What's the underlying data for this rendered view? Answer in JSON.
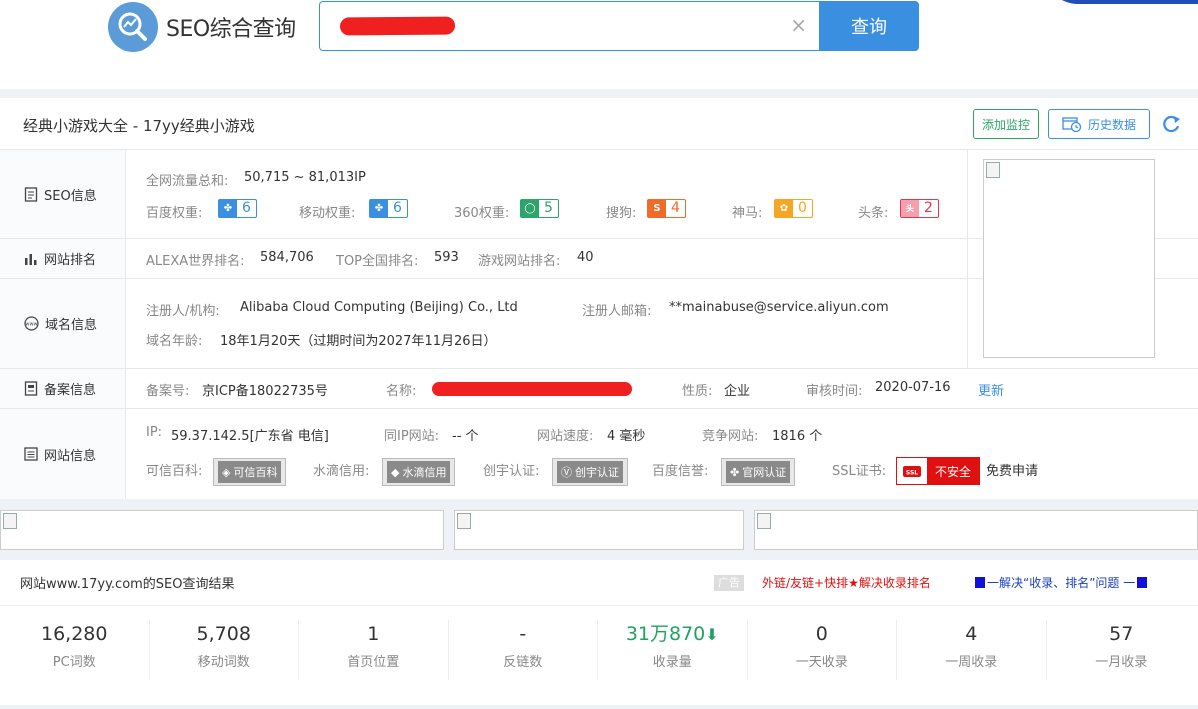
{
  "header": {
    "logo_text": "SEO综合查询",
    "search_button": "查询",
    "clear_symbol": "×"
  },
  "site": {
    "title": "经典小游戏大全 - 17yy经典小游戏",
    "btn_monitor": "添加监控",
    "btn_history": "历史数据"
  },
  "seo": {
    "label": "SEO信息",
    "traffic_label": "全网流量总和:",
    "traffic_value": "50,715 ~ 81,013IP",
    "ranks": [
      {
        "label": "百度权重:",
        "value": "6",
        "color": "#3b8fe0",
        "icon": "baidu-paw-icon"
      },
      {
        "label": "移动权重:",
        "value": "6",
        "color": "#3b8fe0",
        "icon": "baidu-paw-icon"
      },
      {
        "label": "360权重:",
        "value": "5",
        "color": "#2ea36a",
        "icon": "360-icon"
      },
      {
        "label": "搜狗:",
        "value": "4",
        "color": "#f06a28",
        "icon": "sogou-icon"
      },
      {
        "label": "神马:",
        "value": "0",
        "color": "#f5a623",
        "icon": "shenma-icon"
      },
      {
        "label": "头条:",
        "value": "2",
        "color": "#e8344f",
        "icon": "toutiao-icon"
      }
    ]
  },
  "ranking": {
    "label": "网站排名",
    "alexa_label": "ALEXA世界排名:",
    "alexa_value": "584,706",
    "top_label": "TOP全国排名:",
    "top_value": "593",
    "game_label": "游戏网站排名:",
    "game_value": "40"
  },
  "domain": {
    "label": "域名信息",
    "registrant_label": "注册人/机构:",
    "registrant_value": "Alibaba Cloud Computing (Beijing) Co., Ltd",
    "email_label": "注册人邮箱:",
    "email_value": "**mainabuse@service.aliyun.com",
    "age_label": "域名年龄:",
    "age_value": "18年1月20天（过期时间为2027年11月26日）"
  },
  "beian": {
    "label": "备案信息",
    "number_label": "备案号:",
    "number_value": "京ICP备18022735号",
    "name_label": "名称:",
    "nature_label": "性质:",
    "nature_value": "企业",
    "audit_label": "审核时间:",
    "audit_value": "2020-07-16",
    "update_link": "更新"
  },
  "siteinfo": {
    "label": "网站信息",
    "ip_label": "IP:",
    "ip_value": "59.37.142.5[广东省 电信]",
    "sameip_label": "同IP网站:",
    "sameip_value": "-- 个",
    "speed_label": "网站速度:",
    "speed_value": "4 毫秒",
    "compete_label": "竞争网站:",
    "compete_value": "1816 个",
    "kexin_label": "可信百科:",
    "kexin_badge": "可信百科",
    "shuidi_label": "水滴信用:",
    "shuidi_badge": "水滴信用",
    "chuangyu_label": "创宇认证:",
    "chuangyu_badge": "创宇认证",
    "baidu_label": "百度信誉:",
    "baidu_badge": "官网认证",
    "ssl_label": "SSL证书:",
    "ssl_badge": "不安全",
    "ssl_icon_text": "SSL",
    "ssl_apply": "免费申请"
  },
  "results": {
    "title": "网站www.17yy.com的SEO查询结果",
    "ad_tag": "广告",
    "ad_link1": "外链/友链+快排★解决收录排名",
    "ad_link2": "一解决“收录、排名”问题 一",
    "stats": [
      {
        "value": "16,280",
        "label": "PC词数"
      },
      {
        "value": "5,708",
        "label": "移动词数"
      },
      {
        "value": "1",
        "label": "首页位置"
      },
      {
        "value": "-",
        "label": "反链数"
      },
      {
        "value": "31万870",
        "label": "收录量",
        "trend": "down"
      },
      {
        "value": "0",
        "label": "一天收录"
      },
      {
        "value": "4",
        "label": "一周收录"
      },
      {
        "value": "57",
        "label": "一月收录"
      }
    ]
  }
}
